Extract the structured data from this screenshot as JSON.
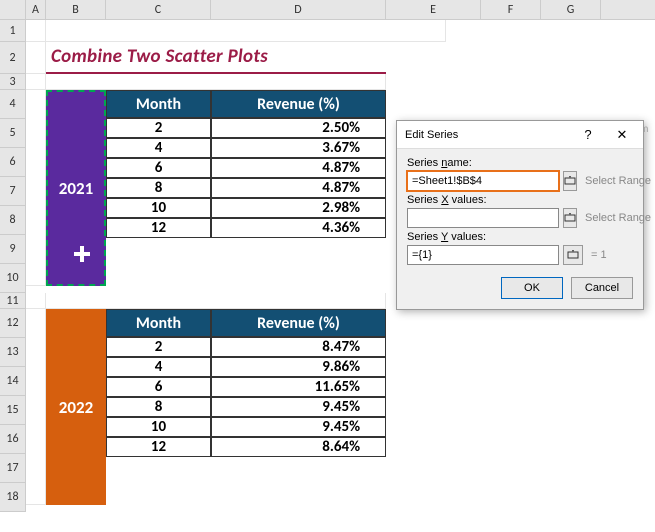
{
  "columns": {
    "A": "A",
    "B": "B",
    "C": "C",
    "D": "D",
    "E": "E",
    "F": "F",
    "G": "G"
  },
  "rows": [
    "1",
    "2",
    "3",
    "4",
    "5",
    "6",
    "7",
    "8",
    "9",
    "10",
    "11",
    "12",
    "13",
    "14",
    "15",
    "16",
    "17",
    "18"
  ],
  "title": "Combine Two Scatter Plots",
  "tables": [
    {
      "year": "2021",
      "headers": {
        "month": "Month",
        "revenue": "Revenue (%)"
      },
      "rows": [
        {
          "month": "2",
          "revenue": "2.50%"
        },
        {
          "month": "4",
          "revenue": "3.67%"
        },
        {
          "month": "6",
          "revenue": "4.87%"
        },
        {
          "month": "8",
          "revenue": "4.87%"
        },
        {
          "month": "10",
          "revenue": "2.98%"
        },
        {
          "month": "12",
          "revenue": "4.36%"
        }
      ]
    },
    {
      "year": "2022",
      "headers": {
        "month": "Month",
        "revenue": "Revenue (%)"
      },
      "rows": [
        {
          "month": "2",
          "revenue": "8.47%"
        },
        {
          "month": "4",
          "revenue": "9.86%"
        },
        {
          "month": "6",
          "revenue": "11.65%"
        },
        {
          "month": "8",
          "revenue": "9.45%"
        },
        {
          "month": "10",
          "revenue": "9.45%"
        },
        {
          "month": "12",
          "revenue": "8.64%"
        }
      ]
    }
  ],
  "dialog": {
    "title": "Edit Series",
    "help_symbol": "?",
    "close_symbol": "✕",
    "labels": {
      "series_name": "Series name:",
      "series_x": "Series X values:",
      "series_y": "Series Y values:"
    },
    "fields": {
      "series_name": "=Sheet1!$B$4",
      "series_x": "",
      "series_y": "={1}"
    },
    "hints": {
      "series_name": "Select Range",
      "series_x": "Select Range",
      "series_y": "= 1"
    },
    "buttons": {
      "ok": "OK",
      "cancel": "Cancel"
    }
  },
  "watermark": "wsxdn.com",
  "chart_data": {
    "type": "scatter",
    "title": "Combine Two Scatter Plots",
    "xlabel": "Month",
    "ylabel": "Revenue (%)",
    "x": [
      2,
      4,
      6,
      8,
      10,
      12
    ],
    "series": [
      {
        "name": "2021",
        "values": [
          2.5,
          3.67,
          4.87,
          4.87,
          2.98,
          4.36
        ]
      },
      {
        "name": "2022",
        "values": [
          8.47,
          9.86,
          11.65,
          9.45,
          9.45,
          8.64
        ]
      }
    ],
    "xlim": [
      0,
      14
    ],
    "ylim": [
      0,
      12
    ]
  }
}
